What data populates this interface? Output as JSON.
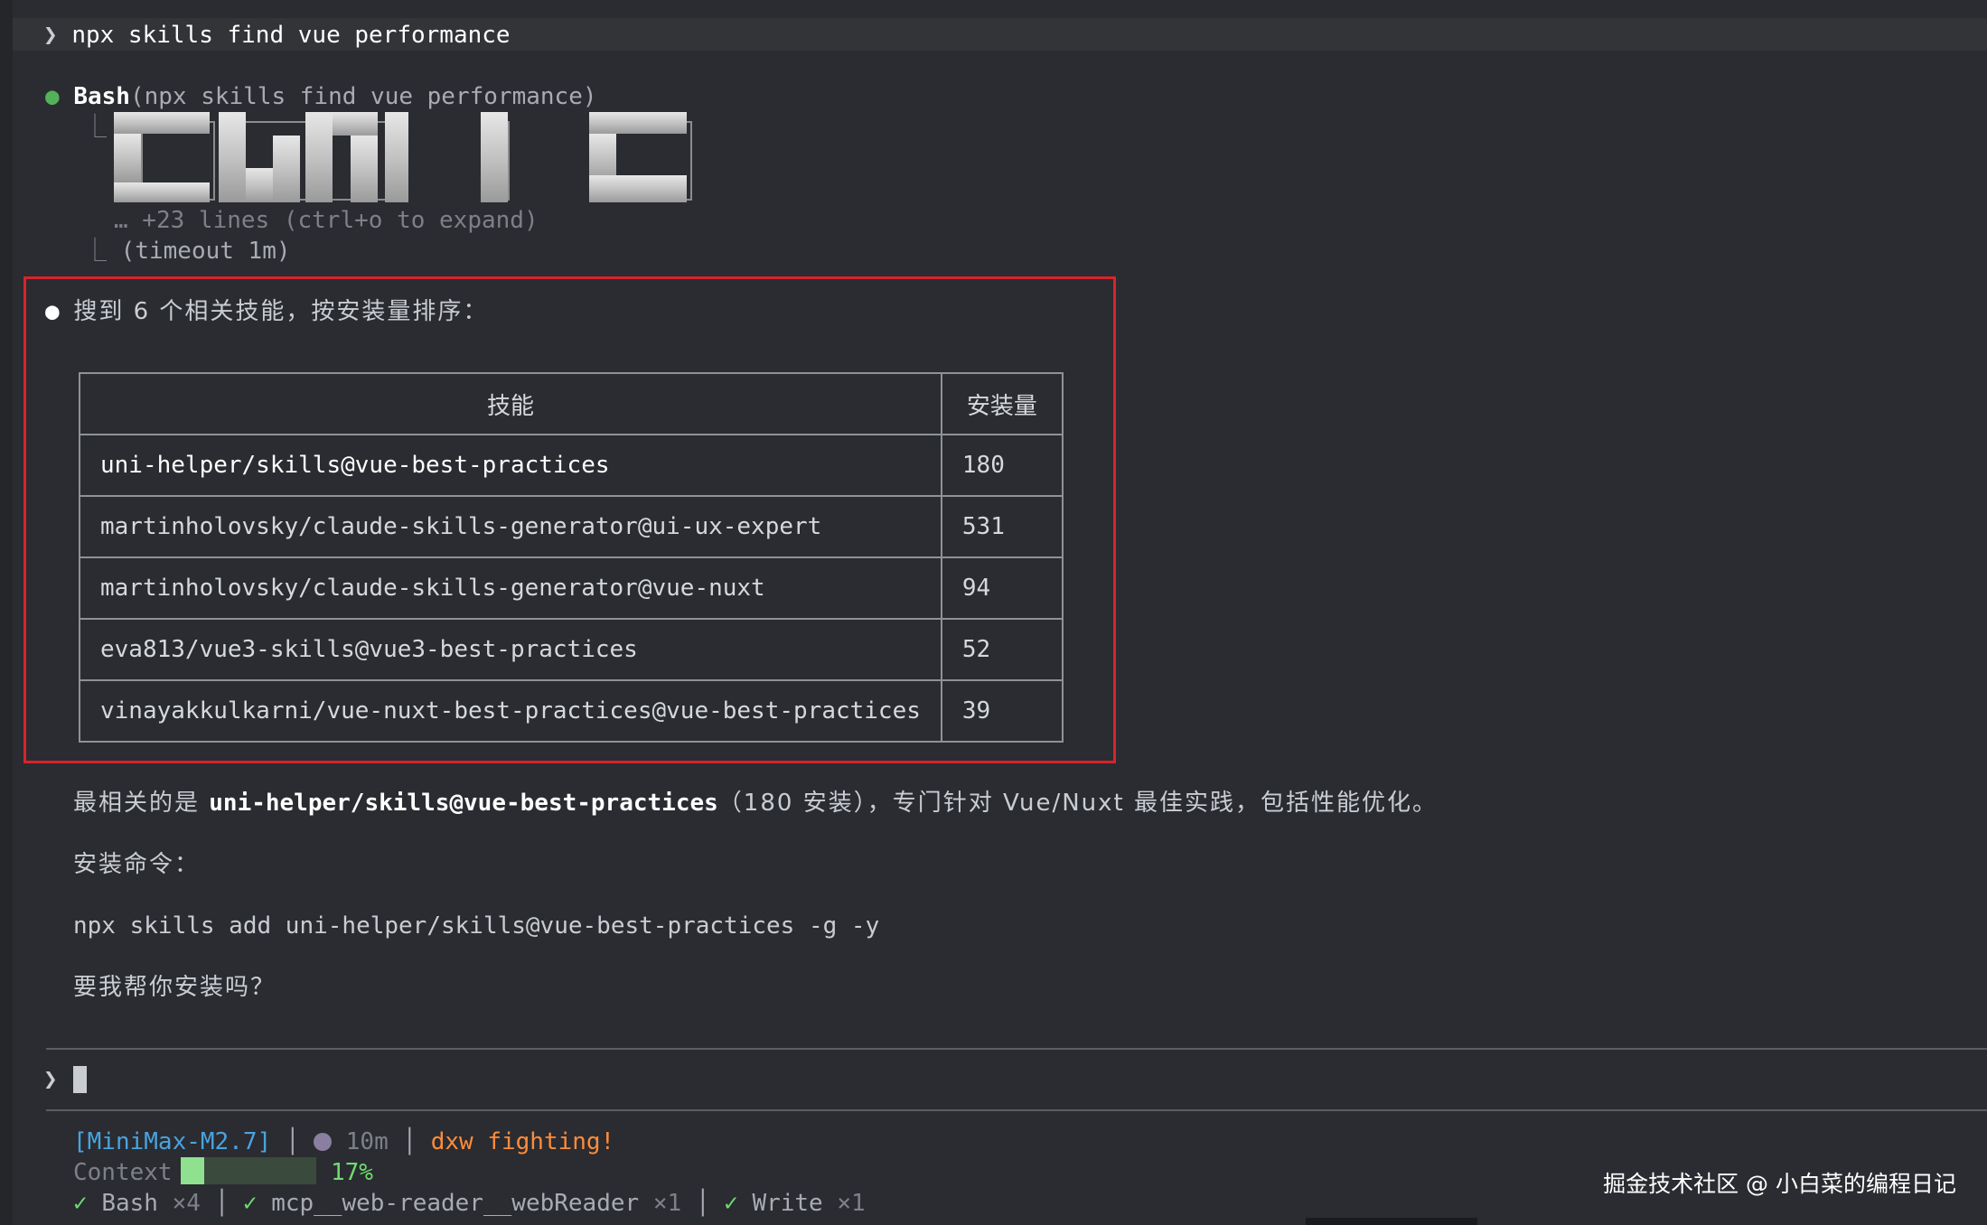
{
  "prompt": {
    "chevron": "❯",
    "command": "npx skills find vue performance"
  },
  "tool_call": {
    "bullet": "●",
    "tool_name": "Bash",
    "tool_args": "(npx skills find vue performance)",
    "tree_glyph": "⎿",
    "more_lines": "… +23 lines (ctrl+o to expand)",
    "timeout_note": "(timeout 1m)"
  },
  "result": {
    "bullet": "●",
    "summary": "搜到 6 个相关技能，按安装量排序：",
    "table": {
      "headers": [
        "技能",
        "安装量"
      ],
      "rows": [
        {
          "skill": "uni-helper/skills@vue-best-practices",
          "installs": "180"
        },
        {
          "skill": "martinholovsky/claude-skills-generator@ui-ux-expert",
          "installs": "531"
        },
        {
          "skill": "martinholovsky/claude-skills-generator@vue-nuxt",
          "installs": "94"
        },
        {
          "skill": "eva813/vue3-skills@vue3-best-practices",
          "installs": "52"
        },
        {
          "skill": "vinayakkulkarni/vue-nuxt-best-practices@vue-best-practices",
          "installs": "39"
        }
      ]
    },
    "highlight_color": "#d9232a"
  },
  "followup": {
    "recommend_prefix": "最相关的是 ",
    "recommend_skill": "uni-helper/skills@vue-best-practices",
    "recommend_suffix": "（180 安装），专门针对 Vue/Nuxt 最佳实践，包括性能优化。",
    "install_label": "安装命令：",
    "install_command": "npx skills add uni-helper/skills@vue-best-practices -g -y",
    "question": "要我帮你安装吗？"
  },
  "input": {
    "chevron": "❯"
  },
  "status_bar": {
    "model": "[MiniMax-M2.7]",
    "separator": "│",
    "timer_icon": "clock-icon",
    "elapsed": "10m",
    "tagline": "dxw fighting!",
    "context_label": "Context",
    "context_percent_text": "17%",
    "context_fraction": 0.17,
    "tools": [
      {
        "check": "✓",
        "name": "Bash",
        "count": "×4"
      },
      {
        "check": "✓",
        "name": "mcp__web-reader__webReader",
        "count": "×1"
      },
      {
        "check": "✓",
        "name": "Write",
        "count": "×1"
      }
    ]
  },
  "watermark": "掘金技术社区 @ 小白菜的编程日记",
  "colors": {
    "background": "#2a2c31",
    "bullet_green": "#55b05a",
    "model_blue": "#4aa3df",
    "tagline_orange": "#ff8c3a",
    "check_green": "#6fdc6f"
  }
}
